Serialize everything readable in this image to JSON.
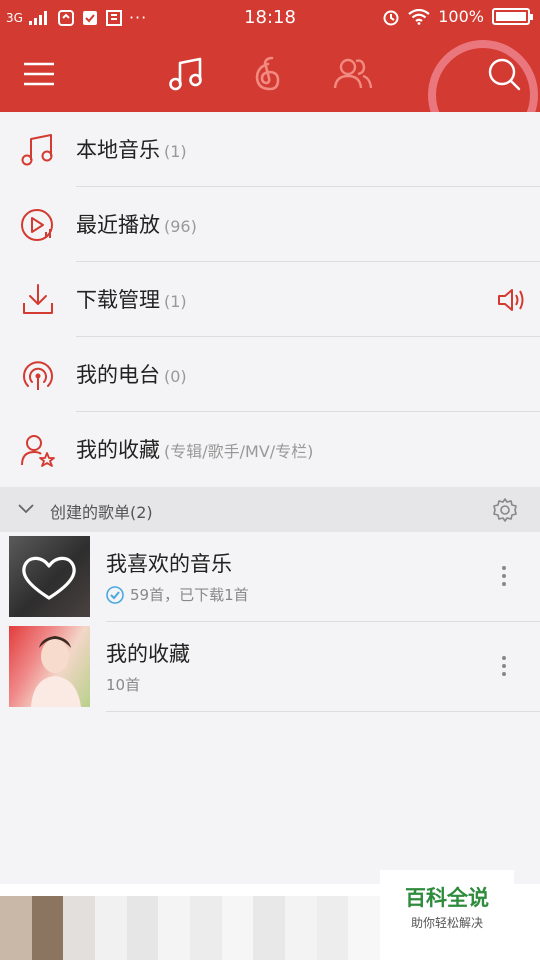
{
  "status_bar": {
    "network": "3G",
    "time": "18:18",
    "battery": "100%"
  },
  "nav": {
    "tabs": [
      {
        "name": "my-music-tab",
        "icon": "music-note-icon",
        "active": true
      },
      {
        "name": "discover-tab",
        "icon": "netease-logo-icon",
        "active": false
      },
      {
        "name": "friends-tab",
        "icon": "friends-icon",
        "active": false
      }
    ]
  },
  "menu": {
    "items": [
      {
        "label": "本地音乐",
        "count": "(1)",
        "icon": "music-note-icon"
      },
      {
        "label": "最近播放",
        "count": "(96)",
        "icon": "recent-play-icon"
      },
      {
        "label": "下载管理",
        "count": "(1)",
        "icon": "download-icon",
        "trailing_icon": "speaker-icon"
      },
      {
        "label": "我的电台",
        "count": "(0)",
        "icon": "radio-icon"
      },
      {
        "label": "我的收藏",
        "count": "(专辑/歌手/MV/专栏)",
        "icon": "favorites-icon"
      }
    ]
  },
  "playlists_section": {
    "title": "创建的歌单(2)"
  },
  "playlists": [
    {
      "title": "我喜欢的音乐",
      "subtitle": "59首，已下载1首",
      "downloaded": true
    },
    {
      "title": "我的收藏",
      "subtitle": "10首",
      "downloaded": false
    }
  ],
  "watermark": {
    "main": "百科全说",
    "sub": "助你轻松解决"
  },
  "colors": {
    "brand_red": "#d33a31",
    "icon_red": "#d33a31",
    "accent_blue": "#4aa8e0",
    "watermark_green": "#2e8c3c"
  }
}
